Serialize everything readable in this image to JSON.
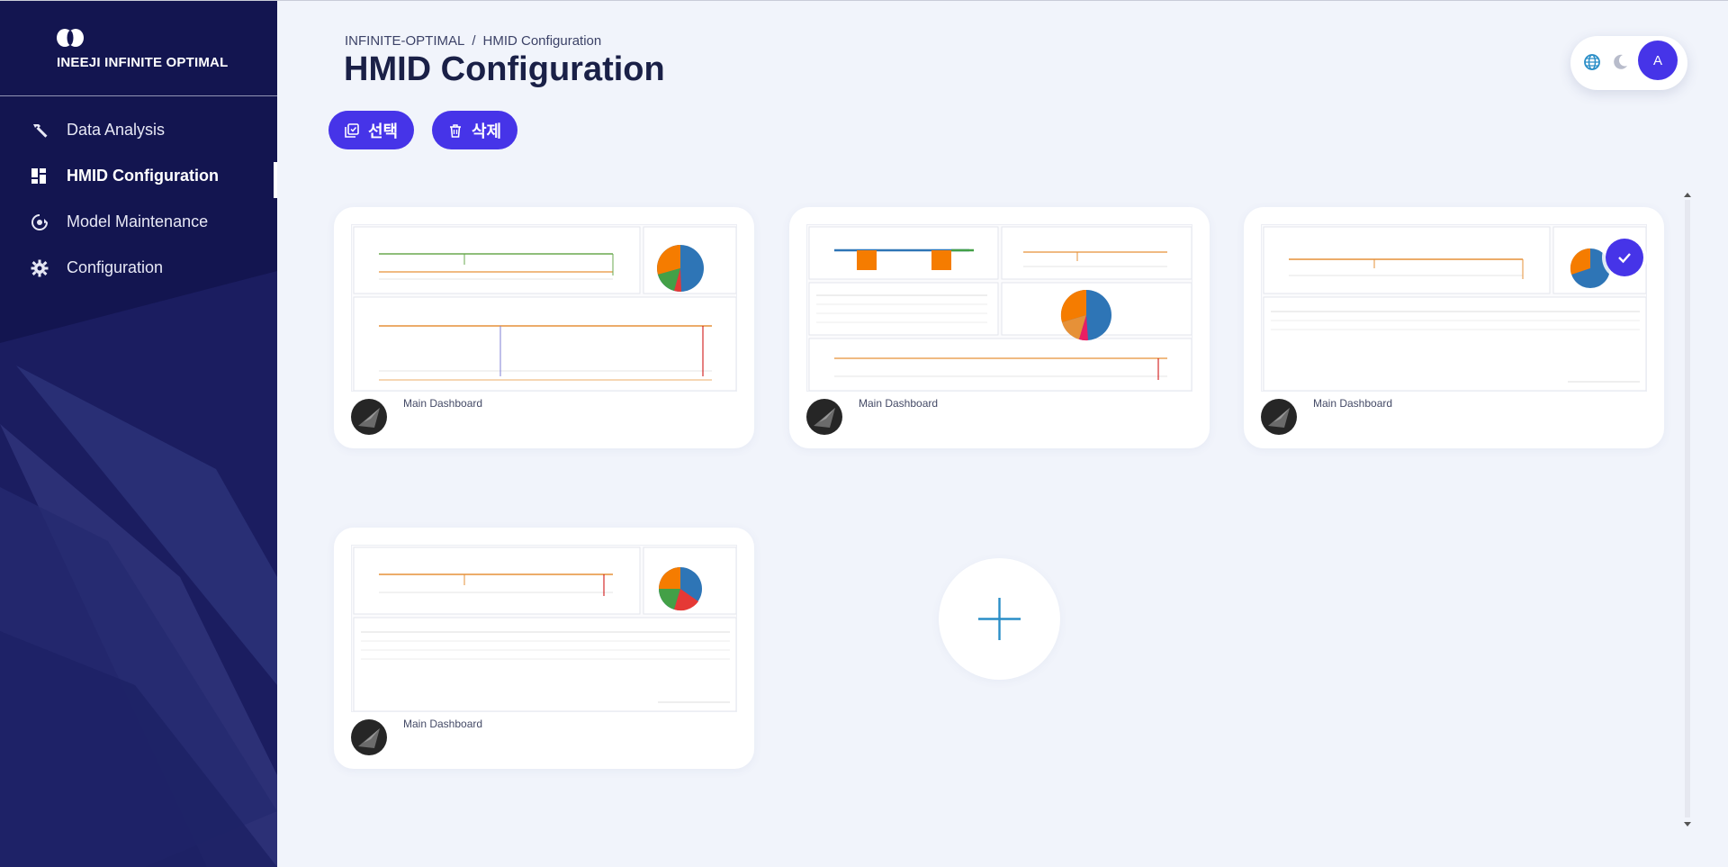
{
  "sidebar": {
    "logo_text": "INEEJI  INFINITE OPTIMAL",
    "items": [
      {
        "label": "Data Analysis",
        "icon": "hammer-icon"
      },
      {
        "label": "HMID Configuration",
        "icon": "dashboard-icon",
        "active": true
      },
      {
        "label": "Model Maintenance",
        "icon": "refresh-gear-icon"
      },
      {
        "label": "Configuration",
        "icon": "gear-icon"
      }
    ]
  },
  "header": {
    "breadcrumb": [
      "INFINITE-OPTIMAL",
      "HMID Configuration"
    ],
    "breadcrumb_separator": "/",
    "title": "HMID Configuration"
  },
  "toolbar": {
    "select_label": "선택",
    "delete_label": "삭제"
  },
  "top_right": {
    "avatar_initial": "A",
    "icons": [
      "globe-icon",
      "moon-icon"
    ]
  },
  "dashboards": [
    {
      "name": "Main Dashboard",
      "selected": false
    },
    {
      "name": "Main Dashboard",
      "selected": false
    },
    {
      "name": "Main Dashboard",
      "selected": true
    },
    {
      "name": "Main Dashboard",
      "selected": false
    }
  ],
  "add_button": {
    "icon": "plus-icon"
  },
  "colors": {
    "sidebar_bg": "#131550",
    "accent": "#4634e8",
    "page_bg": "#f1f4fb",
    "add_icon": "#2a8ec7"
  }
}
